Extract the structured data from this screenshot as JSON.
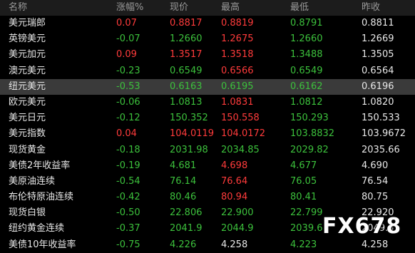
{
  "headers": {
    "name": "名称",
    "change": "涨幅%",
    "price": "现价",
    "high": "最高",
    "low": "最低",
    "prev": "昨收"
  },
  "colors": {
    "up": "#ff3b3b",
    "down": "#3cc13c",
    "selected_row": "#3a3a3a"
  },
  "rows": [
    {
      "name": "美元瑞郎",
      "change": "0.07",
      "price": "0.8817",
      "high": "0.8819",
      "low": "0.8791",
      "prev": "0.8811",
      "dir": "up",
      "price_dir": "up",
      "high_dir": "up",
      "low_dir": "down"
    },
    {
      "name": "英镑美元",
      "change": "-0.07",
      "price": "1.2660",
      "high": "1.2675",
      "low": "1.2660",
      "prev": "1.2669",
      "dir": "down",
      "price_dir": "down",
      "high_dir": "up",
      "low_dir": "down"
    },
    {
      "name": "美元加元",
      "change": "0.09",
      "price": "1.3517",
      "high": "1.3518",
      "low": "1.3488",
      "prev": "1.3505",
      "dir": "up",
      "price_dir": "up",
      "high_dir": "up",
      "low_dir": "down"
    },
    {
      "name": "澳元美元",
      "change": "-0.23",
      "price": "0.6549",
      "high": "0.6566",
      "low": "0.6549",
      "prev": "0.6564",
      "dir": "down",
      "price_dir": "down",
      "high_dir": "up",
      "low_dir": "down"
    },
    {
      "name": "纽元美元",
      "change": "-0.53",
      "price": "0.6163",
      "high": "0.6195",
      "low": "0.6162",
      "prev": "0.6196",
      "dir": "down",
      "price_dir": "down",
      "high_dir": "down",
      "low_dir": "down",
      "selected": true
    },
    {
      "name": "欧元美元",
      "change": "-0.06",
      "price": "1.0813",
      "high": "1.0831",
      "low": "1.0812",
      "prev": "1.0820",
      "dir": "down",
      "price_dir": "down",
      "high_dir": "up",
      "low_dir": "down"
    },
    {
      "name": "美元日元",
      "change": "-0.12",
      "price": "150.352",
      "high": "150.558",
      "low": "150.293",
      "prev": "150.533",
      "dir": "down",
      "price_dir": "down",
      "high_dir": "up",
      "low_dir": "down"
    },
    {
      "name": "美元指数",
      "change": "0.04",
      "price": "104.0119",
      "high": "104.0172",
      "low": "103.8832",
      "prev": "103.9672",
      "dir": "up",
      "price_dir": "up",
      "high_dir": "up",
      "low_dir": "down"
    },
    {
      "name": "现货黄金",
      "change": "-0.18",
      "price": "2031.98",
      "high": "2034.85",
      "low": "2029.82",
      "prev": "2035.66",
      "dir": "down",
      "price_dir": "down",
      "high_dir": "down",
      "low_dir": "down"
    },
    {
      "name": "美债2年收益率",
      "change": "-0.19",
      "price": "4.681",
      "high": "4.698",
      "low": "4.677",
      "prev": "4.690",
      "dir": "down",
      "price_dir": "down",
      "high_dir": "up",
      "low_dir": "down"
    },
    {
      "name": "美原油连续",
      "change": "-0.54",
      "price": "76.14",
      "high": "76.64",
      "low": "76.05",
      "prev": "76.54",
      "dir": "down",
      "price_dir": "down",
      "high_dir": "up",
      "low_dir": "down"
    },
    {
      "name": "布伦特原油连续",
      "change": "-0.42",
      "price": "80.46",
      "high": "80.94",
      "low": "80.41",
      "prev": "80.75",
      "dir": "down",
      "price_dir": "down",
      "high_dir": "up",
      "low_dir": "down"
    },
    {
      "name": "现货白银",
      "change": "-0.50",
      "price": "22.806",
      "high": "22.900",
      "low": "22.799",
      "prev": "22.920",
      "dir": "down",
      "price_dir": "down",
      "high_dir": "down",
      "low_dir": "down"
    },
    {
      "name": "纽约黄金连续",
      "change": "-0.37",
      "price": "2041.9",
      "high": "2044.9",
      "low": "2039.6",
      "prev": "2049.5",
      "dir": "down",
      "price_dir": "down",
      "high_dir": "down",
      "low_dir": "down"
    },
    {
      "name": "美债10年收益率",
      "change": "-0.75",
      "price": "4.226",
      "high": "4.258",
      "low": "4.223",
      "prev": "4.258",
      "dir": "down",
      "price_dir": "down",
      "high_dir": "neutral",
      "low_dir": "down"
    }
  ],
  "watermark": "FX678"
}
